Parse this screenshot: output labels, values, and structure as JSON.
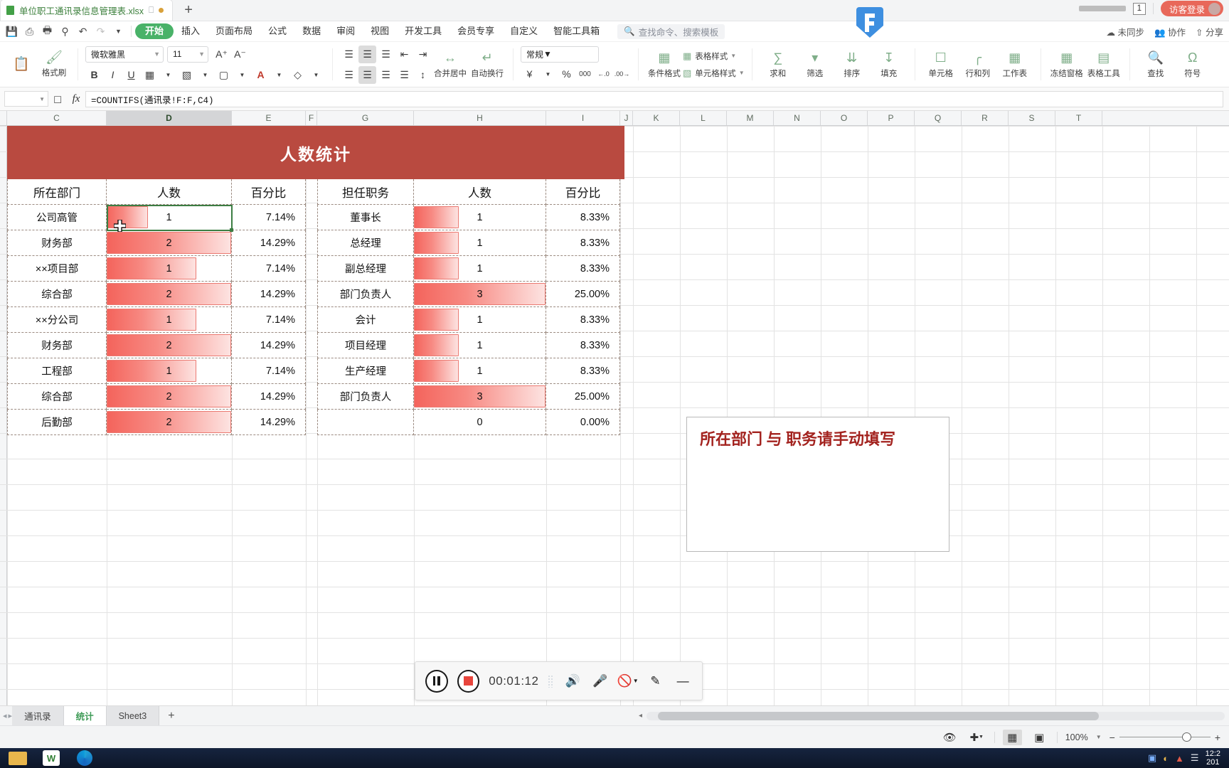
{
  "titlebar": {
    "file_tab": "单位职工通讯录信息管理表.xlsx",
    "new_tab": "+",
    "page_count": "1",
    "login": "访客登录"
  },
  "menubar": {
    "quick_icons": [
      "save-icon",
      "print-preview-icon",
      "print-icon",
      "search-print-icon",
      "undo-icon",
      "redo-icon",
      "customize-icon"
    ],
    "tabs": [
      {
        "label": "开始",
        "active": true
      },
      {
        "label": "插入",
        "active": false
      },
      {
        "label": "页面布局",
        "active": false
      },
      {
        "label": "公式",
        "active": false
      },
      {
        "label": "数据",
        "active": false
      },
      {
        "label": "审阅",
        "active": false
      },
      {
        "label": "视图",
        "active": false
      },
      {
        "label": "开发工具",
        "active": false
      },
      {
        "label": "会员专享",
        "active": false
      },
      {
        "label": "自定义",
        "active": false
      },
      {
        "label": "智能工具箱",
        "active": false
      }
    ],
    "search_placeholder": "查找命令、搜索模板",
    "right_items": [
      "未同步",
      "协作",
      "分享"
    ]
  },
  "ribbon": {
    "format_painter": "格式刷",
    "font_name": "微软雅黑",
    "font_size": "11",
    "merge_center": "合并居中",
    "wrap_text": "自动换行",
    "number_format": "常规",
    "conditional_format": "条件格式",
    "table_style": "表格样式",
    "cell_style": "单元格样式",
    "groups": [
      {
        "label": "求和",
        "icon": "sum-icon"
      },
      {
        "label": "筛选",
        "icon": "filter-icon"
      },
      {
        "label": "排序",
        "icon": "sort-icon"
      },
      {
        "label": "填充",
        "icon": "fill-icon"
      },
      {
        "label": "单元格",
        "icon": "cell-icon"
      },
      {
        "label": "行和列",
        "icon": "row-col-icon"
      },
      {
        "label": "工作表",
        "icon": "worksheet-icon"
      },
      {
        "label": "冻结窗格",
        "icon": "freeze-icon"
      },
      {
        "label": "表格工具",
        "icon": "table-tools-icon"
      },
      {
        "label": "查找",
        "icon": "find-icon"
      },
      {
        "label": "符号",
        "icon": "symbol-icon"
      }
    ]
  },
  "formula_bar": {
    "name_box": "",
    "formula": "=COUNTIFS(通讯录!F:F,C4)"
  },
  "columns": [
    "C",
    "D",
    "E",
    "F",
    "G",
    "H",
    "I",
    "J",
    "K",
    "L",
    "M",
    "N",
    "O",
    "P",
    "Q",
    "R",
    "S",
    "T"
  ],
  "selected_column": "D",
  "report": {
    "title": "人数统计",
    "left_table": {
      "headers": [
        "所在部门",
        "人数",
        "百分比"
      ],
      "rows": [
        {
          "name": "公司高管",
          "count": "1",
          "pct": "7.14%",
          "bar": 33
        },
        {
          "name": "财务部",
          "count": "2",
          "pct": "14.29%",
          "bar": 100
        },
        {
          "name": "××项目部",
          "count": "1",
          "pct": "7.14%",
          "bar": 72
        },
        {
          "name": "综合部",
          "count": "2",
          "pct": "14.29%",
          "bar": 100
        },
        {
          "name": "××分公司",
          "count": "1",
          "pct": "7.14%",
          "bar": 72
        },
        {
          "name": "财务部",
          "count": "2",
          "pct": "14.29%",
          "bar": 100
        },
        {
          "name": "工程部",
          "count": "1",
          "pct": "7.14%",
          "bar": 72
        },
        {
          "name": "综合部",
          "count": "2",
          "pct": "14.29%",
          "bar": 100
        },
        {
          "name": "后勤部",
          "count": "2",
          "pct": "14.29%",
          "bar": 100
        }
      ]
    },
    "right_table": {
      "headers": [
        "担任职务",
        "人数",
        "百分比"
      ],
      "rows": [
        {
          "name": "董事长",
          "count": "1",
          "pct": "8.33%",
          "bar": 34
        },
        {
          "name": "总经理",
          "count": "1",
          "pct": "8.33%",
          "bar": 34
        },
        {
          "name": "副总经理",
          "count": "1",
          "pct": "8.33%",
          "bar": 34
        },
        {
          "name": "部门负责人",
          "count": "3",
          "pct": "25.00%",
          "bar": 100
        },
        {
          "name": "会计",
          "count": "1",
          "pct": "8.33%",
          "bar": 34
        },
        {
          "name": "项目经理",
          "count": "1",
          "pct": "8.33%",
          "bar": 34
        },
        {
          "name": "生产经理",
          "count": "1",
          "pct": "8.33%",
          "bar": 34
        },
        {
          "name": "部门负责人",
          "count": "3",
          "pct": "25.00%",
          "bar": 100
        },
        {
          "name": "",
          "count": "0",
          "pct": "0.00%",
          "bar": 0
        }
      ]
    },
    "note": "所在部门 与 职务请手动填写"
  },
  "recorder": {
    "time": "00:01:12",
    "buttons": [
      "pause-button",
      "stop-button",
      "speaker-icon",
      "microphone-icon",
      "camera-off-icon",
      "pen-icon",
      "minimize-icon"
    ]
  },
  "sheet_tabs": [
    {
      "label": "通讯录",
      "active": false
    },
    {
      "label": "统计",
      "active": true
    },
    {
      "label": "Sheet3",
      "active": false
    }
  ],
  "sheet_add": "+",
  "statusbar": {
    "zoom": "100%",
    "view_buttons": [
      "normal-view-icon",
      "page-layout-icon"
    ],
    "left_icons": [
      "eye-icon",
      "center-icon"
    ]
  },
  "taskbar": {
    "clock_time": "12:2",
    "clock_date": "201"
  },
  "colors": {
    "banner_red": "#b94a40",
    "bar_red": "#f4645c",
    "bar_pale": "#fde3e1",
    "accent_green": "#49b268",
    "note_red": "#a3231f",
    "selection_green": "#3c7d43",
    "login_red": "#e8685a"
  }
}
